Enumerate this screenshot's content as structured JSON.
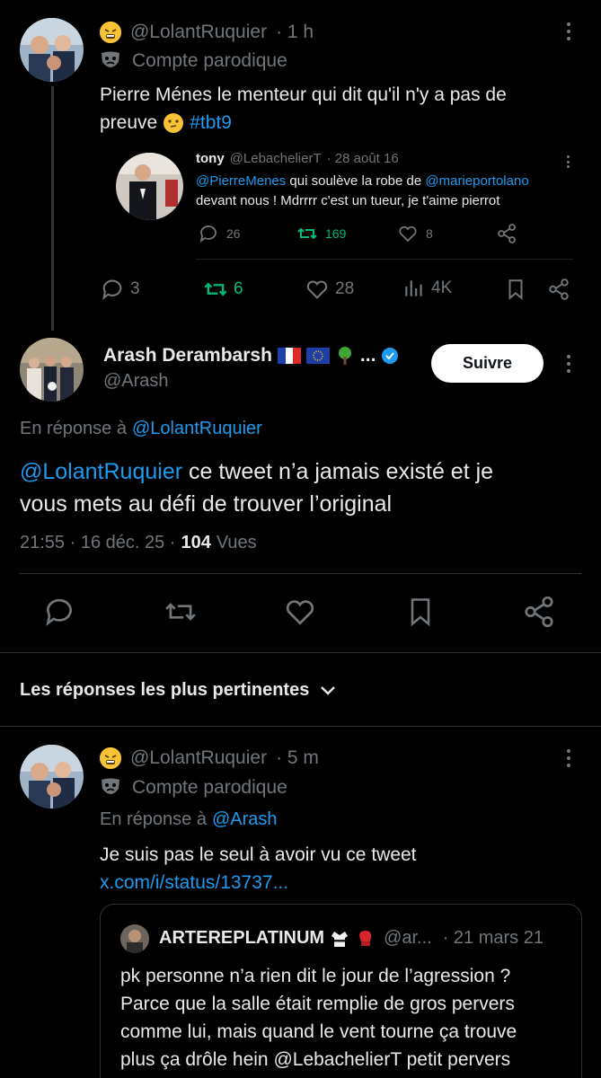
{
  "tweet1": {
    "handle": "@LolantRuquier",
    "time": "· 1 h",
    "label": "Compte parodique",
    "text_main": "Pierre Ménes le menteur qui dit qu'il n'y a pas de",
    "text_second": "preuve",
    "hashtag": "#tbt9",
    "quoted": {
      "name": "tony",
      "handle": "@LebachelierT",
      "date": "· 28 août 16",
      "mention1": "@PierreMenes",
      "text1": " qui soulève la robe de ",
      "mention2": "@marieportolano",
      "text2": "devant nous ! Mdrrrr c'est un tueur, je t'aime pierrot",
      "replies": "26",
      "retweets": "169",
      "likes": "8"
    },
    "replies": "3",
    "retweets": "6",
    "likes": "28",
    "views": "4K"
  },
  "main_tweet": {
    "name": "Arash Derambarsh",
    "name_suffix": "...",
    "handle": "@Arash",
    "follow_label": "Suivre",
    "reply_prefix": "En réponse à",
    "reply_to": "@LolantRuquier",
    "mention": "@LolantRuquier",
    "text_line1": " ce tweet n’a jamais existé et je",
    "text_line2": "vous mets au défi de trouver l’original",
    "time": "21:55 · 16 déc. 25 ·",
    "views_count": "104",
    "views_label": "Vues"
  },
  "replies_header": {
    "label": "Les réponses les plus pertinentes"
  },
  "reply1": {
    "handle": "@LolantRuquier",
    "time": "· 5 m",
    "label": "Compte parodique",
    "reply_prefix": "En réponse à",
    "reply_to": "@Arash",
    "text": "Je suis pas le seul à avoir vu ce tweet",
    "link": "x.com/i/status/13737...",
    "quoted": {
      "name": "ARTEREPLATINUM",
      "handle": "@ar...",
      "date": "· 21 mars 21",
      "line1": "pk personne n’a rien dit le jour de l’agression ?",
      "line2": "Parce que la salle était remplie de gros pervers",
      "line3": "comme lui, mais quand le vent tourne ça trouve",
      "line4": "plus ça drôle hein @LebachelierT petit pervers"
    }
  },
  "colors": {
    "background": "#000000",
    "text": "#e7e9ea",
    "muted": "#71767b",
    "accent": "#1d9bf0",
    "retweet_green": "#00ba7c",
    "divider": "#2f3336",
    "follow_button_bg": "#ffffff"
  }
}
